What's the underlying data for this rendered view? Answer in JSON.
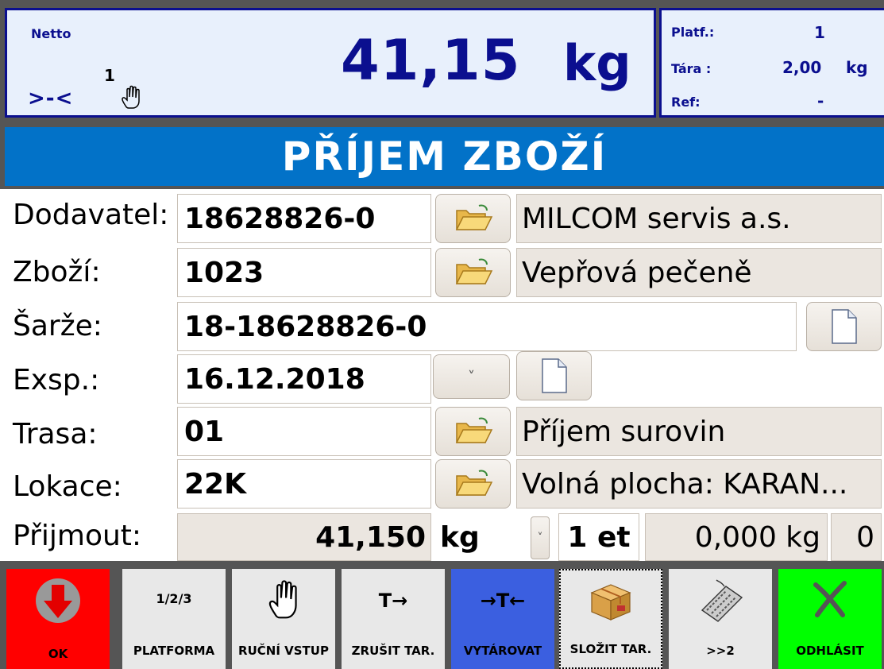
{
  "scale": {
    "netto_label": "Netto",
    "platform_indicator": "1",
    "zero_indicator": ">-<",
    "weight": "41,15",
    "unit": "kg",
    "side": {
      "platform_label": "Platf.:",
      "platform_value": "1",
      "tare_label": "Tára :",
      "tare_value": "2,00",
      "tare_unit": "kg",
      "ref_label": "Ref:",
      "ref_value": "-"
    }
  },
  "title": "PŘÍJEM ZBOŽÍ",
  "form": {
    "supplier": {
      "label": "Dodavatel:",
      "value": "18628826-0",
      "desc": "MILCOM servis a.s."
    },
    "goods": {
      "label": "Zboží:",
      "value": "1023",
      "desc": "Vepřová pečeně"
    },
    "batch": {
      "label": "Šarže:",
      "value": "18-18628826-0"
    },
    "expiry": {
      "label": "Exsp.:",
      "value": "16.12.2018",
      "dropdown_icon": "˅"
    },
    "route": {
      "label": "Trasa:",
      "value": "01",
      "desc": "Příjem surovin"
    },
    "location": {
      "label": "Lokace:",
      "value": "22K",
      "desc": "Volná plocha: KARAN..."
    },
    "receive": {
      "label": "Přijmout:",
      "amount": "41,150",
      "unit": "kg",
      "dropdown_icon": "˅",
      "count": "1 et",
      "second_amount": "0,000 kg",
      "last": "0"
    }
  },
  "toolbar": {
    "ok": "OK",
    "platform_top": "1/2/3",
    "platform": "PLATFORMA",
    "manual": "RUČNÍ VSTUP",
    "cancel_tare_top": "T→",
    "cancel_tare": "ZRUŠIT TAR.",
    "tare_top": "→T←",
    "tare": "VYTÁROVAT",
    "compose_tare": "SLOŽIT TAR.",
    "next_page": ">>2",
    "logout": "ODHLÁSIT"
  },
  "colors": {
    "display_bg": "#e8f0fc",
    "display_text": "#0b0f8f",
    "title_bg": "#0272c8",
    "ok_bg": "#ff0000",
    "tare_bg": "#3b5fe0",
    "logout_bg": "#00ff00"
  },
  "icons": [
    "hand-icon",
    "folder-open-icon",
    "document-icon",
    "chevron-down-icon",
    "arrow-down-circle-icon",
    "package-icon",
    "keyboard-icon",
    "x-logout-icon"
  ]
}
